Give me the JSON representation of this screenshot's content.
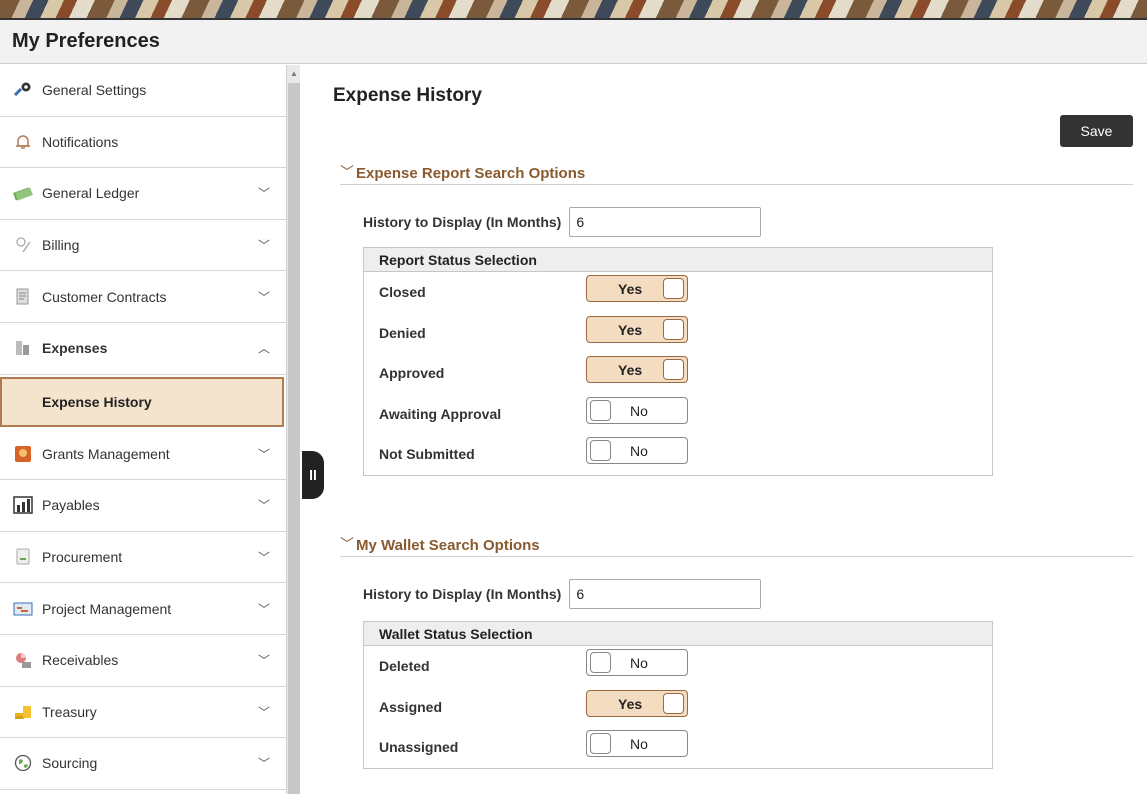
{
  "page": {
    "title": "My Preferences"
  },
  "sidebar": {
    "items": [
      {
        "label": "General Settings",
        "icon": "wrench-gear-icon",
        "expandable": false
      },
      {
        "label": "Notifications",
        "icon": "bell-icon",
        "expandable": false
      },
      {
        "label": "General Ledger",
        "icon": "money-icon",
        "expandable": true,
        "chevron": "﹀"
      },
      {
        "label": "Billing",
        "icon": "billing-icon",
        "expandable": true,
        "chevron": "﹀"
      },
      {
        "label": "Customer Contracts",
        "icon": "contract-icon",
        "expandable": true,
        "chevron": "﹀"
      },
      {
        "label": "Expenses",
        "icon": "expenses-icon",
        "expandable": true,
        "chevron": "︿"
      },
      {
        "label": "Grants Management",
        "icon": "grants-icon",
        "expandable": true,
        "chevron": "﹀"
      },
      {
        "label": "Payables",
        "icon": "payables-icon",
        "expandable": true,
        "chevron": "﹀"
      },
      {
        "label": "Procurement",
        "icon": "procurement-icon",
        "expandable": true,
        "chevron": "﹀"
      },
      {
        "label": "Project Management",
        "icon": "project-icon",
        "expandable": true,
        "chevron": "﹀"
      },
      {
        "label": "Receivables",
        "icon": "receivables-icon",
        "expandable": true,
        "chevron": "﹀"
      },
      {
        "label": "Treasury",
        "icon": "treasury-icon",
        "expandable": true,
        "chevron": "﹀"
      },
      {
        "label": "Sourcing",
        "icon": "globe-icon",
        "expandable": true,
        "chevron": "﹀"
      }
    ],
    "selected_sub_item": "Expense History"
  },
  "main": {
    "title": "Expense History",
    "save_label": "Save",
    "report_section": {
      "title": "Expense Report Search Options",
      "history_label": "History to Display (In Months)",
      "history_value": "6",
      "group_title": "Report Status Selection",
      "statuses": [
        {
          "label": "Closed",
          "value": "Yes"
        },
        {
          "label": "Denied",
          "value": "Yes"
        },
        {
          "label": "Approved",
          "value": "Yes"
        },
        {
          "label": "Awaiting Approval",
          "value": "No"
        },
        {
          "label": "Not Submitted",
          "value": "No"
        }
      ]
    },
    "wallet_section": {
      "title": "My Wallet Search Options",
      "history_label": "History to Display (In Months)",
      "history_value": "6",
      "group_title": "Wallet Status Selection",
      "statuses": [
        {
          "label": "Deleted",
          "value": "No"
        },
        {
          "label": "Assigned",
          "value": "Yes"
        },
        {
          "label": "Unassigned",
          "value": "No"
        }
      ]
    }
  },
  "colors": {
    "accent": "#8a5a2e",
    "toggle_on": "#f4dcc0",
    "selected_bg": "#f4e3cd",
    "save_bg": "#333333"
  }
}
